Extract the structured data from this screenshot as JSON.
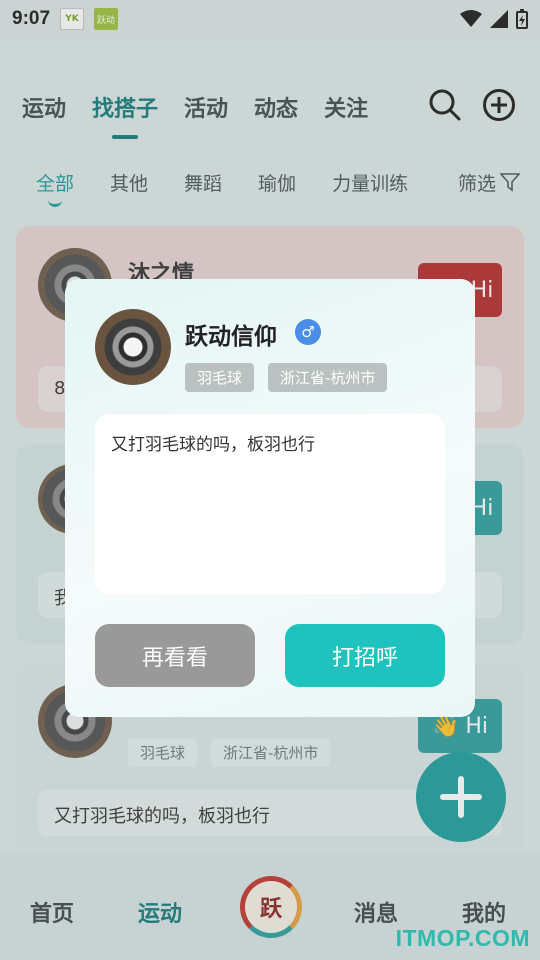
{
  "status_bar": {
    "time": "9:07",
    "app_icons": [
      "YK",
      "跃动"
    ]
  },
  "top_tabs": [
    "运动",
    "找搭子",
    "活动",
    "动态",
    "关注"
  ],
  "top_tab_active": 1,
  "sub_tabs": [
    "全部",
    "其他",
    "舞蹈",
    "瑜伽",
    "力量训练"
  ],
  "sub_tab_active": 0,
  "filter_label": "筛选",
  "cards": [
    {
      "name": "沐之情",
      "hi_label": "Hi",
      "message_partial": "8"
    },
    {
      "hi_label": "Hi",
      "message_partial": "我"
    },
    {
      "tags": [
        "羽毛球",
        "浙江省-杭州市"
      ],
      "hi_label": "Hi",
      "message": "又打羽毛球的吗，板羽也行"
    }
  ],
  "modal": {
    "name": "跃动信仰",
    "gender_symbol": "♂",
    "tags": [
      "羽毛球",
      "浙江省-杭州市"
    ],
    "message": "又打羽毛球的吗，板羽也行",
    "btn_later": "再看看",
    "btn_greet": "打招呼"
  },
  "bottom_nav": {
    "home": "首页",
    "sport": "运动",
    "logo_text": "跃",
    "messages": "消息",
    "mine": "我的"
  },
  "watermark": "ITMOP.COM",
  "colors": {
    "accent": "#1fc2bc",
    "teal_dark": "#107a7a",
    "hi_red": "#b62a2a",
    "gender_blue": "#4a8ee8"
  }
}
